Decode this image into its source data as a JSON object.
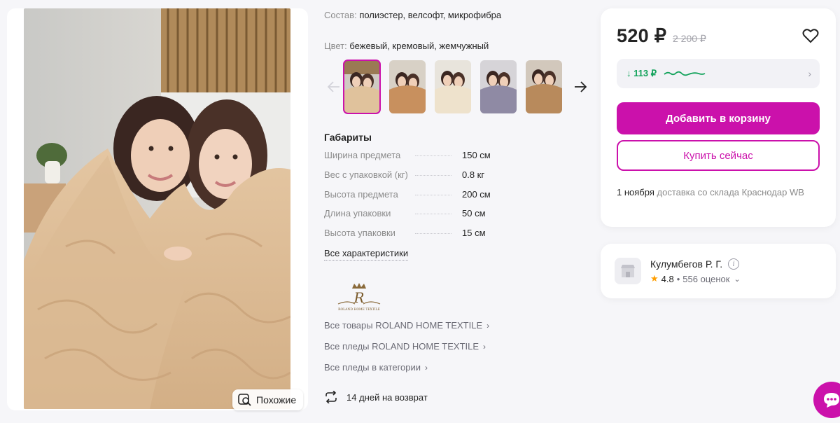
{
  "product": {
    "composition_label": "Состав:",
    "composition_value": "полиэстер, велсофт, микрофибра",
    "color_label": "Цвет:",
    "color_value": "бежевый, кремовый, жемчужный",
    "similar_label": "Похожие",
    "dimensions_title": "Габариты",
    "specs": [
      {
        "name": "Ширина предмета",
        "value": "150 см"
      },
      {
        "name": "Вес с упаковкой (кг)",
        "value": "0.8 кг"
      },
      {
        "name": "Высота предмета",
        "value": "200 см"
      },
      {
        "name": "Длина упаковки",
        "value": "50 см"
      },
      {
        "name": "Высота упаковки",
        "value": "15 см"
      }
    ],
    "all_characteristics": "Все характеристики",
    "brand_logo_text": "ROLAND HOME TEXTILE",
    "links": [
      "Все товары ROLAND HOME TEXTILE",
      "Все пледы ROLAND HOME TEXTILE",
      "Все пледы в категории"
    ],
    "return_policy": "14 дней на возврат"
  },
  "buy_box": {
    "price": "520 ₽",
    "old_price": "2 200 ₽",
    "price_drop": "↓ 113 ₽",
    "add_to_cart": "Добавить в корзину",
    "buy_now": "Купить сейчас",
    "delivery_date": "1 ноября",
    "delivery_text": "доставка со склада Краснодар WB"
  },
  "seller": {
    "name": "Кулумбегов Р. Г.",
    "rating": "4.8",
    "separator": "•",
    "reviews": "556 оценок"
  },
  "colors": {
    "accent": "#cb11ab",
    "price_drop": "#14a35c",
    "star": "#ff9e00"
  },
  "icons": [
    "similar-search-icon",
    "arrow-left-icon",
    "arrow-right-icon",
    "heart-icon",
    "chevron-right-icon",
    "info-icon",
    "star-icon",
    "chevron-down-icon",
    "return-arrows-icon",
    "chat-icon",
    "shop-icon"
  ]
}
